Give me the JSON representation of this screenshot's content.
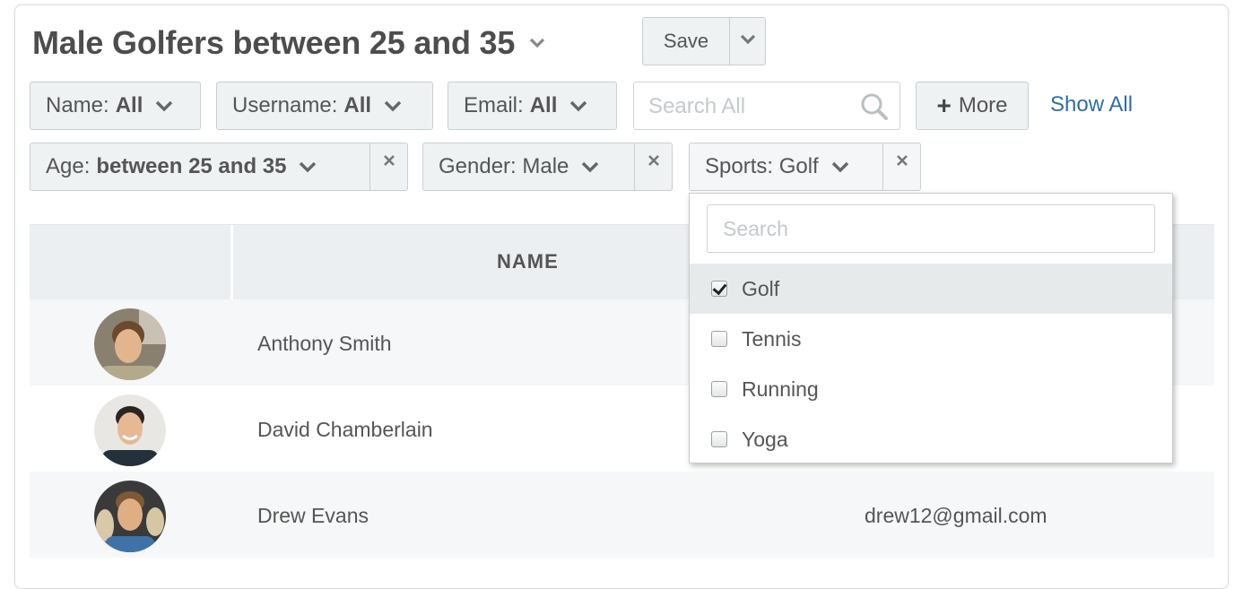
{
  "header": {
    "title": "Male Golfers between 25 and 35",
    "save_label": "Save"
  },
  "filters": {
    "name": {
      "label": "Name:",
      "value": "All"
    },
    "username": {
      "label": "Username:",
      "value": "All"
    },
    "email": {
      "label": "Email:",
      "value": "All"
    },
    "search_placeholder": "Search All",
    "more_label": "More",
    "show_all_label": "Show All"
  },
  "active_filters": {
    "age": {
      "label": "Age:",
      "value": "between 25 and 35"
    },
    "gender": {
      "label": "Gender: Male"
    },
    "sports": {
      "label": "Sports: Golf"
    }
  },
  "dropdown": {
    "search_placeholder": "Search",
    "options": [
      {
        "label": "Golf",
        "checked": true
      },
      {
        "label": "Tennis",
        "checked": false
      },
      {
        "label": "Running",
        "checked": false
      },
      {
        "label": "Yoga",
        "checked": false
      }
    ]
  },
  "table": {
    "headers": {
      "name": "NAME"
    },
    "rows": [
      {
        "name": "Anthony Smith",
        "email": ""
      },
      {
        "name": "David Chamberlain",
        "email": ""
      },
      {
        "name": "Drew Evans",
        "email": "drew12@gmail.com"
      }
    ]
  },
  "icons": {
    "caret": "chevron-down-icon",
    "remove": "close-icon",
    "search": "search-icon",
    "plus": "plus-icon"
  },
  "colors": {
    "link": "#2e6ea6",
    "chip_bg": "#eef2f3",
    "header_bg": "#eceff1"
  }
}
